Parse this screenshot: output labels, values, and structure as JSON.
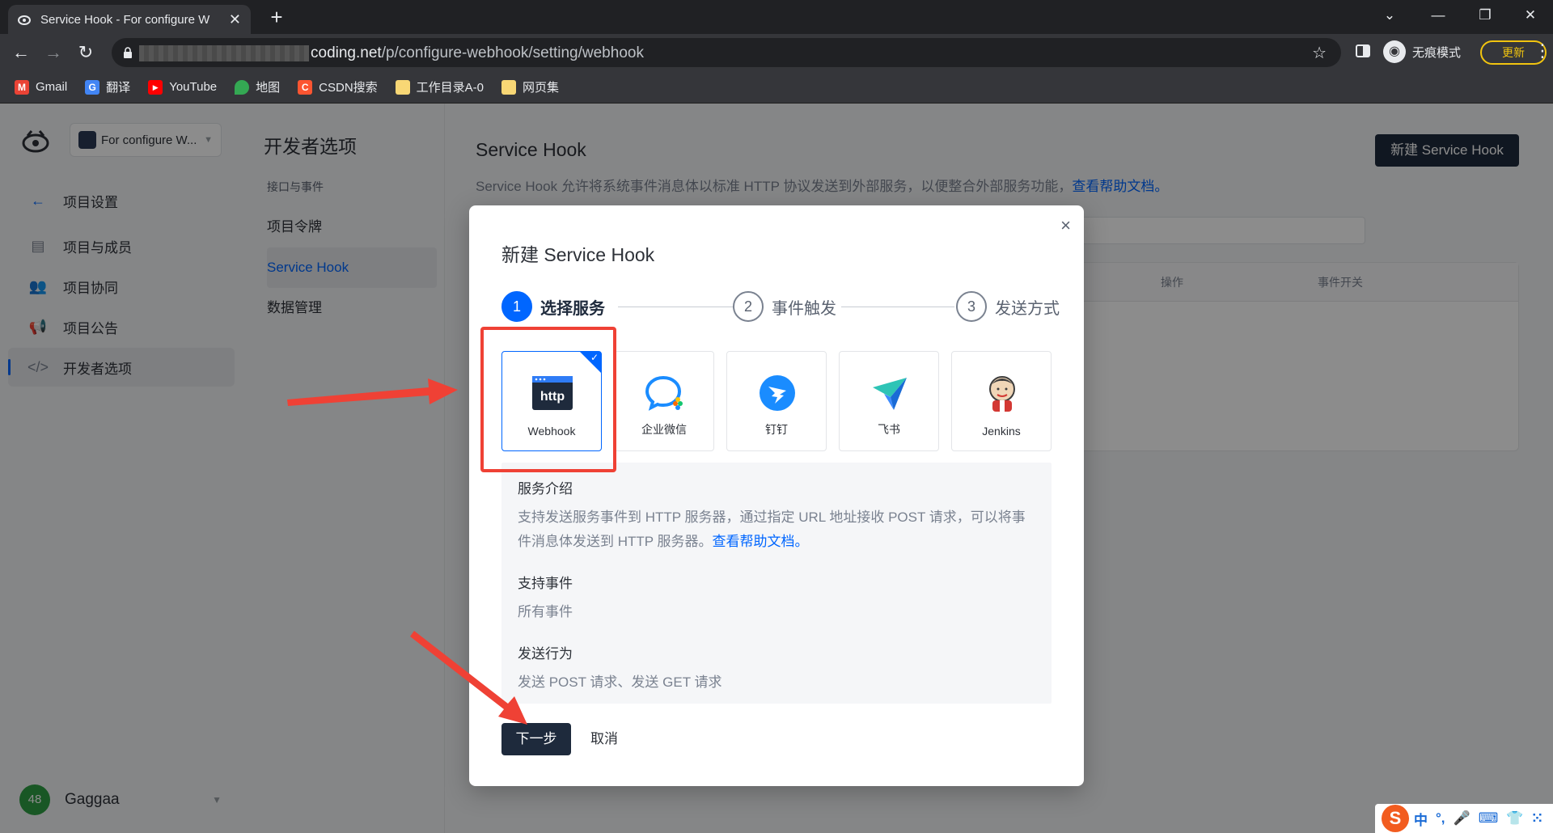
{
  "browser": {
    "tab_title": "Service Hook - For configure W",
    "url_host": "coding.net",
    "url_path": "/p/configure-webhook/setting/webhook",
    "incognito_label": "无痕模式",
    "update_label": "更新",
    "bookmarks": [
      {
        "label": "Gmail",
        "icon": "gmail-icon",
        "color": "#ea4335"
      },
      {
        "label": "翻译",
        "icon": "translate-icon",
        "color": "#4285f4"
      },
      {
        "label": "YouTube",
        "icon": "youtube-icon",
        "color": "#ff0000"
      },
      {
        "label": "地图",
        "icon": "maps-icon",
        "color": "#34a853"
      },
      {
        "label": "CSDN搜索",
        "icon": "csdn-icon",
        "color": "#fc5531"
      },
      {
        "label": "工作目录A-0",
        "icon": "folder-icon",
        "color": "#f8d775"
      },
      {
        "label": "网页集",
        "icon": "folder-icon",
        "color": "#f8d775"
      }
    ]
  },
  "sidebar": {
    "project_name": "For configure W...",
    "items": [
      {
        "label": "项目设置",
        "icon": "back-arrow-icon"
      },
      {
        "label": "项目与成员",
        "icon": "members-icon"
      },
      {
        "label": "项目协同",
        "icon": "collab-icon"
      },
      {
        "label": "项目公告",
        "icon": "announce-icon"
      },
      {
        "label": "开发者选项",
        "icon": "code-icon"
      }
    ],
    "user": {
      "avatar": "48",
      "name": "Gaggaa"
    }
  },
  "sub_sidebar": {
    "title": "开发者选项",
    "items": [
      "接口与事件",
      "项目令牌",
      "Service Hook",
      "数据管理"
    ]
  },
  "page": {
    "title": "Service Hook",
    "desc": "Service Hook 允许将系统事件消息体以标准 HTTP 协议发送到外部服务，以便整合外部服务功能，",
    "desc_link": "查看帮助文档。",
    "new_button": "新建 Service Hook",
    "columns": [
      "操作",
      "事件开关"
    ]
  },
  "modal": {
    "title": "新建 Service Hook",
    "close": "×",
    "steps": [
      {
        "num": "1",
        "label": "选择服务"
      },
      {
        "num": "2",
        "label": "事件触发"
      },
      {
        "num": "3",
        "label": "发送方式"
      }
    ],
    "services": [
      {
        "label": "Webhook",
        "icon": "http-icon"
      },
      {
        "label": "企业微信",
        "icon": "wecom-icon"
      },
      {
        "label": "钉钉",
        "icon": "dingtalk-icon"
      },
      {
        "label": "飞书",
        "icon": "feishu-icon"
      },
      {
        "label": "Jenkins",
        "icon": "jenkins-icon"
      }
    ],
    "info": {
      "intro_title": "服务介绍",
      "intro_text": "支持发送服务事件到 HTTP 服务器，通过指定 URL 地址接收 POST 请求，可以将事件消息体发送到 HTTP 服务器。",
      "intro_link": "查看帮助文档。",
      "events_title": "支持事件",
      "events_text": "所有事件",
      "behavior_title": "发送行为",
      "behavior_text": "发送 POST 请求、发送 GET 请求"
    },
    "next_button": "下一步",
    "cancel_button": "取消"
  },
  "ime": {
    "items": [
      "中",
      "°,",
      "🎤",
      "⌨",
      "👕",
      "⁙"
    ]
  },
  "colors": {
    "accent": "#0066ff",
    "dark_button": "#1e2a3c",
    "annotation": "#ef4135"
  }
}
